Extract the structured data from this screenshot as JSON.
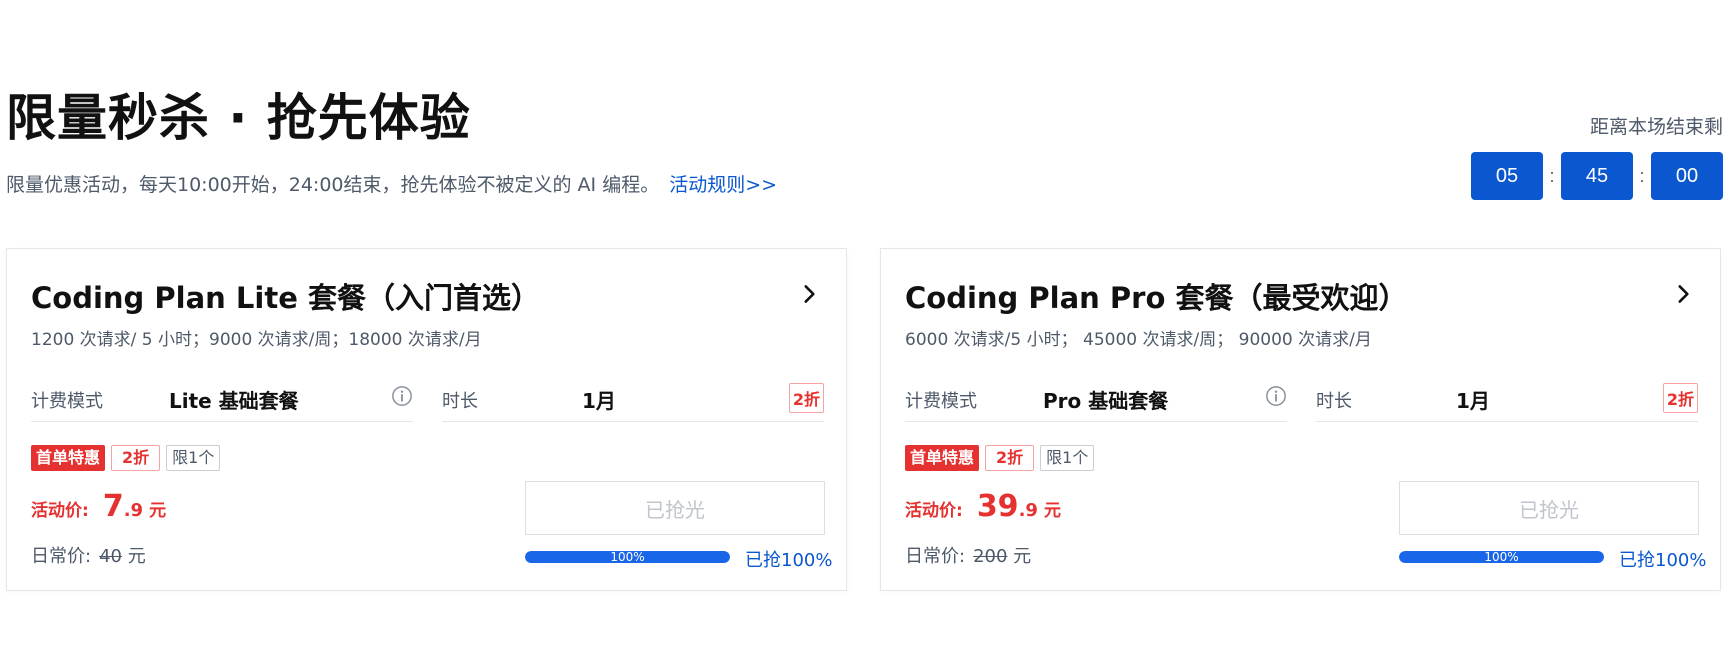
{
  "hero": {
    "title": "限量秒杀 · 抢先体验",
    "subtitle": "限量优惠活动，每天10:00开始，24:00结束，抢先体验不被定义的 AI 编程。",
    "rules_link": "活动规则>>"
  },
  "countdown": {
    "label": "距离本场结束剩",
    "hours": "05",
    "minutes": "45",
    "seconds": "00",
    "separator": ":"
  },
  "cards": [
    {
      "title": "Coding Plan Lite 套餐（入门首选）",
      "quota": "1200 次请求/ 5 小时；9000 次请求/周；18000 次请求/月",
      "billing_label": "计费模式",
      "billing_value": "Lite 基础套餐",
      "duration_label": "时长",
      "duration_value": "1月",
      "duration_discount": "2折",
      "tag_first": "首单特惠",
      "tag_discount": "2折",
      "tag_limit": "限1个",
      "price_label": "活动价:",
      "price_int": "7",
      "price_dec": ".9",
      "price_unit": "元",
      "regular_label": "日常价:",
      "regular_price": "40",
      "regular_unit": "元",
      "button_label": "已抢光",
      "progress_fraction": 1.0,
      "progress_label": "100%",
      "progress_text": "已抢100%"
    },
    {
      "title": "Coding Plan Pro 套餐（最受欢迎）",
      "quota": "6000 次请求/5 小时； 45000 次请求/周； 90000 次请求/月",
      "billing_label": "计费模式",
      "billing_value": "Pro 基础套餐",
      "duration_label": "时长",
      "duration_value": "1月",
      "duration_discount": "2折",
      "tag_first": "首单特惠",
      "tag_discount": "2折",
      "tag_limit": "限1个",
      "price_label": "活动价:",
      "price_int": "39",
      "price_dec": ".9",
      "price_unit": "元",
      "regular_label": "日常价:",
      "regular_price": "200",
      "regular_unit": "元",
      "button_label": "已抢光",
      "progress_fraction": 1.0,
      "progress_label": "100%",
      "progress_text": "已抢100%"
    }
  ],
  "colors": {
    "brand": "#0b57d0",
    "accent_red": "#e5312f",
    "progress": "#1a66e8"
  },
  "icons": [
    "chevron-right-icon",
    "info-icon"
  ]
}
